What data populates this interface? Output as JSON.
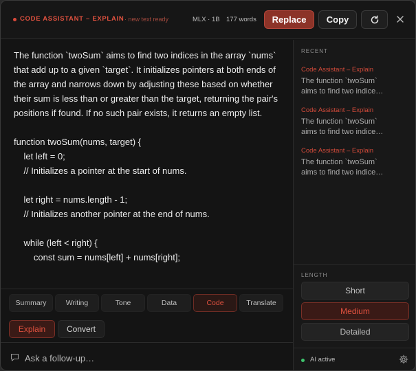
{
  "header": {
    "title": "CODE ASSISTANT – EXPLAIN",
    "subtitle": "· new text ready",
    "model": "MLX · 1B",
    "word_count": "177 words",
    "replace_label": "Replace",
    "copy_label": "Copy",
    "refresh_icon": "refresh-icon",
    "close_icon": "close-icon"
  },
  "content": {
    "paragraph": "The function `twoSum` aims to find two indices in the array `nums` that add up to a given `target`. It initializes pointers at both ends of the array and narrows down by adjusting these based on whether their sum is less than or greater than the target, returning the pair's positions if found. If no such pair exists, it returns an empty list.",
    "code_lines": [
      "function twoSum(nums, target) {",
      "    let left = 0;",
      "    // Initializes a pointer at the start of nums.",
      "",
      "    let right = nums.length - 1;",
      "    // Initializes another pointer at the end of nums.",
      "",
      "    while (left < right) {",
      "        const sum = nums[left] + nums[right];"
    ]
  },
  "tabs": [
    {
      "label": "Summary",
      "active": false
    },
    {
      "label": "Writing",
      "active": false
    },
    {
      "label": "Tone",
      "active": false
    },
    {
      "label": "Data",
      "active": false
    },
    {
      "label": "Code",
      "active": true
    },
    {
      "label": "Translate",
      "active": false
    }
  ],
  "subtabs": {
    "explain_label": "Explain",
    "convert_label": "Convert"
  },
  "followup": {
    "placeholder": "Ask a follow-up…",
    "icon": "chat-icon"
  },
  "sidebar": {
    "recent_label": "RECENT",
    "recent_items": [
      {
        "title": "Code Assistant – Explain",
        "snippet1": "The function `twoSum`",
        "snippet2": "aims to find two indice…"
      },
      {
        "title": "Code Assistant – Explain",
        "snippet1": "The function `twoSum`",
        "snippet2": "aims to find two indice…"
      },
      {
        "title": "Code Assistant – Explain",
        "snippet1": "The function `twoSum`",
        "snippet2": "aims to find two indice…"
      }
    ],
    "length_label": "LENGTH",
    "length_options": [
      "Short",
      "Medium",
      "Detailed"
    ],
    "length_selected": "Medium",
    "status_text": "AI active",
    "status_color": "#3ec46d",
    "settings_icon": "gear-icon"
  },
  "colors": {
    "accent": "#e0513f",
    "accent_dark": "#8c3328",
    "background": "#141414"
  }
}
